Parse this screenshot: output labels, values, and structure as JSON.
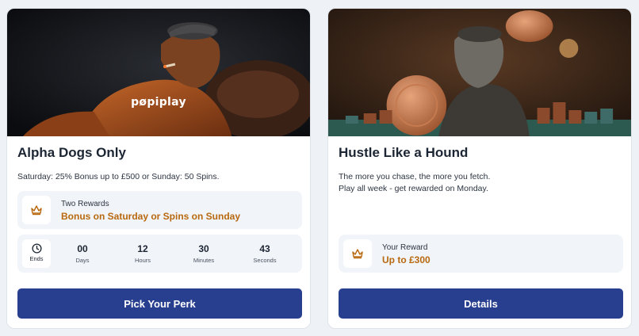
{
  "promos": [
    {
      "banner": {
        "logo_text": "pøpiplay"
      },
      "title": "Alpha Dogs Only",
      "description": [
        "Saturday: 25% Bonus up to £500 or Sunday: 50 Spins."
      ],
      "reward": {
        "icon": "crown-icon",
        "label": "Two Rewards",
        "value": "Bonus on Saturday or Spins on Sunday"
      },
      "countdown": {
        "ends_label": "Ends",
        "units": [
          {
            "value": "00",
            "label": "Days"
          },
          {
            "value": "12",
            "label": "Hours"
          },
          {
            "value": "30",
            "label": "Minutes"
          },
          {
            "value": "43",
            "label": "Seconds"
          }
        ]
      },
      "button_label": "Pick Your Perk"
    },
    {
      "title": "Hustle Like a Hound",
      "description": [
        "The more you chase, the more you fetch.",
        "Play all week - get rewarded on Monday."
      ],
      "reward": {
        "icon": "crown-icon",
        "label": "Your Reward",
        "value": "Up to £300"
      },
      "button_label": "Details"
    }
  ],
  "colors": {
    "accent_button": "#273f8e",
    "reward_text": "#b8690f",
    "panel_bg": "#f1f4f8"
  }
}
